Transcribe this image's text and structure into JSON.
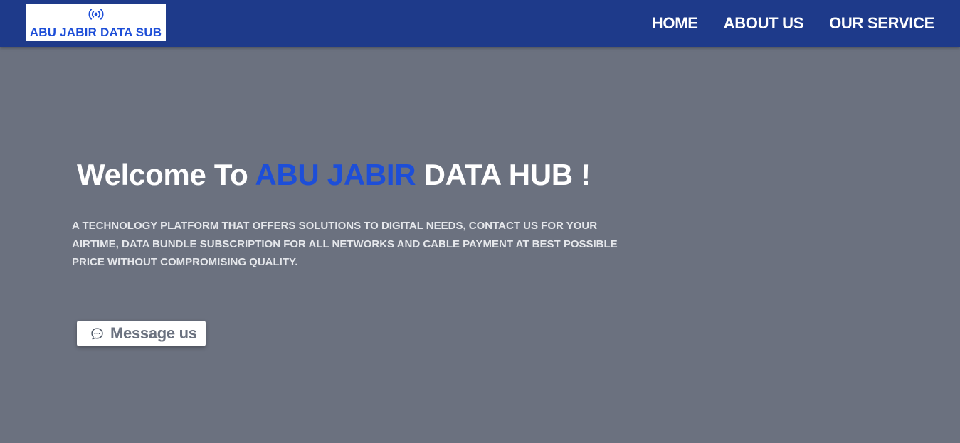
{
  "header": {
    "logo": {
      "icon": "broadcast-icon",
      "text": "ABU JABIR DATA SUB",
      "color": "#1d4ed8"
    },
    "nav": [
      {
        "label": "HOME"
      },
      {
        "label": "ABOUT US"
      },
      {
        "label": "OUR SERVICE"
      }
    ],
    "background": "#1e3a8a"
  },
  "hero": {
    "title_prefix": "Welcome To ",
    "title_highlight": "ABU JABIR",
    "title_suffix": " DATA HUB !",
    "highlight_color": "#1d4ed8",
    "description": "A TECHNOLOGY PLATFORM THAT OFFERS SOLUTIONS TO DIGITAL NEEDS, CONTACT US FOR YOUR AIRTIME, DATA BUNDLE SUBSCRIPTION FOR ALL NETWORKS AND CABLE PAYMENT AT BEST POSSIBLE PRICE WITHOUT COMPROMISING QUALITY.",
    "cta": {
      "icon": "chat-bubble-icon",
      "label": "Message us"
    },
    "background": "#6b717f"
  }
}
